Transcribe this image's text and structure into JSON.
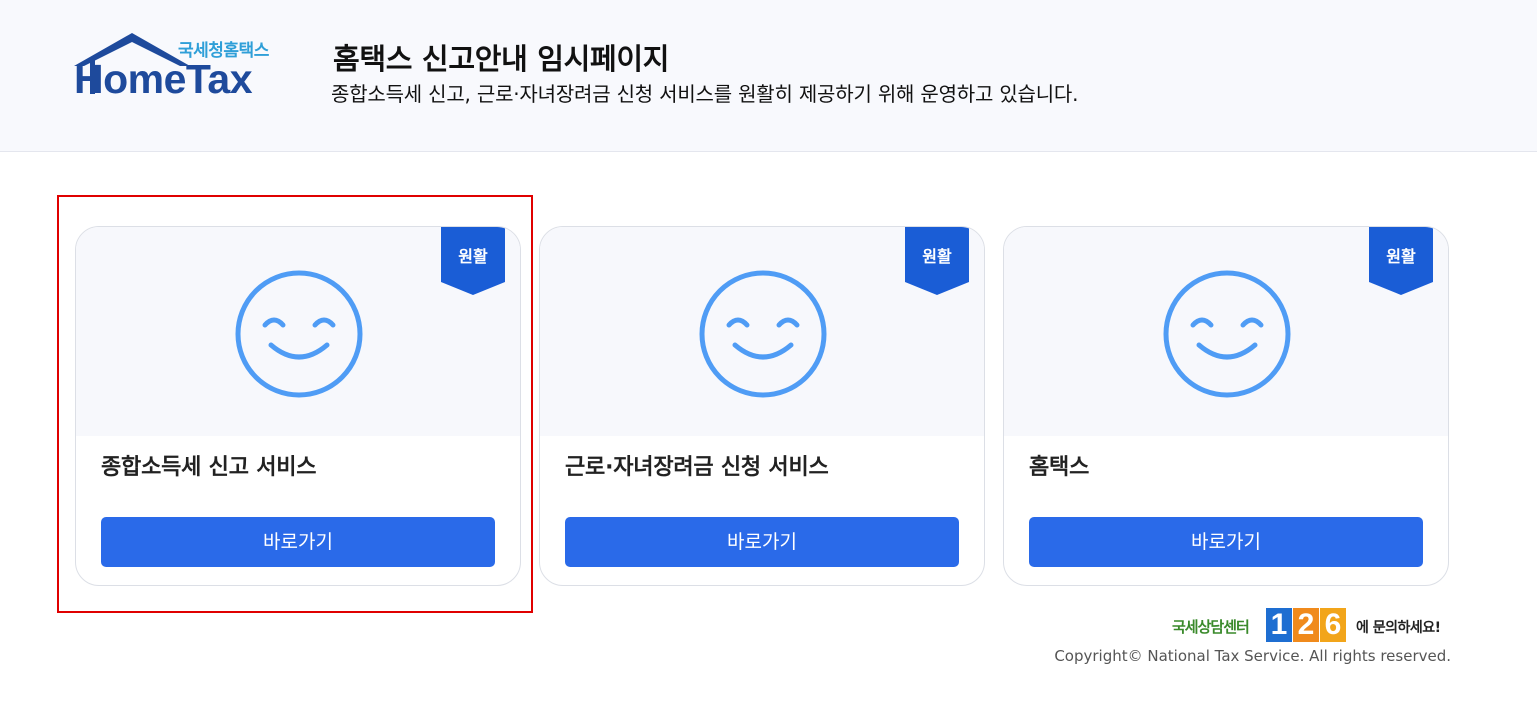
{
  "header": {
    "logo_sub": "국세청홈택스",
    "logo_main": "HomeTax",
    "title": "홈택스 신고안내 임시페이지",
    "description": "종합소득세 신고, 근로·자녀장려금 신청 서비스를 원활히 제공하기 위해 운영하고 있습니다."
  },
  "cards": [
    {
      "badge": "원활",
      "title": "종합소득세 신고 서비스",
      "button": "바로가기",
      "icon": "smile-icon"
    },
    {
      "badge": "원활",
      "title": "근로·자녀장려금 신청 서비스",
      "button": "바로가기",
      "icon": "smile-icon"
    },
    {
      "badge": "원활",
      "title": "홈택스",
      "button": "바로가기",
      "icon": "smile-icon"
    }
  ],
  "footer": {
    "contact_left": "국세상담센터",
    "contact_number": [
      "1",
      "2",
      "6"
    ],
    "contact_right": "에 문의하세요!",
    "copyright": "Copyright© National Tax Service. All rights reserved."
  },
  "colors": {
    "accent": "#2a6ae9",
    "badge": "#1a5dd6",
    "smile": "#4f9cf5",
    "selection": "#e00000",
    "contact_1": "#1e6ed1",
    "contact_2": "#f08a1c",
    "contact_6": "#f2a51a"
  }
}
